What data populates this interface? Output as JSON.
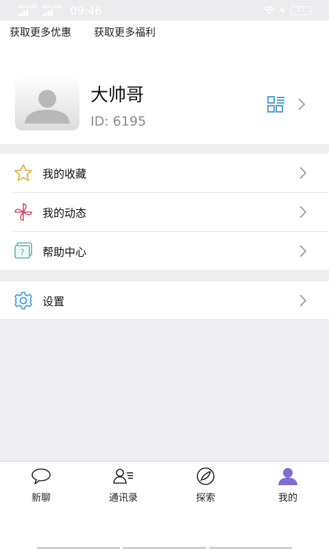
{
  "status_bar": {
    "network1": "4G+HD",
    "network2": "4G+HD",
    "time": "09:46",
    "battery": "27"
  },
  "promo": {
    "link1": "获取更多优惠",
    "link2": "获取更多福利"
  },
  "profile": {
    "name": "大帅哥",
    "id_text": "ID: 6195"
  },
  "menu": [
    {
      "label": "我的收藏",
      "icon": "star-icon"
    },
    {
      "label": "我的动态",
      "icon": "pinwheel-icon"
    },
    {
      "label": "帮助中心",
      "icon": "help-icon"
    },
    {
      "label": "设置",
      "icon": "gear-icon"
    }
  ],
  "tabs": [
    {
      "label": "新聊",
      "icon": "chat-bubble-icon"
    },
    {
      "label": "通讯录",
      "icon": "contacts-icon"
    },
    {
      "label": "探索",
      "icon": "explore-icon"
    },
    {
      "label": "我的",
      "icon": "user-icon",
      "active": true
    }
  ],
  "colors": {
    "accent": "#7b6fd6",
    "icon_blue": "#4a9fd6",
    "star": "#e0b23a",
    "pinwheel": "#d14a6a",
    "help": "#5fb3a8",
    "separator": "#eeeef1"
  }
}
